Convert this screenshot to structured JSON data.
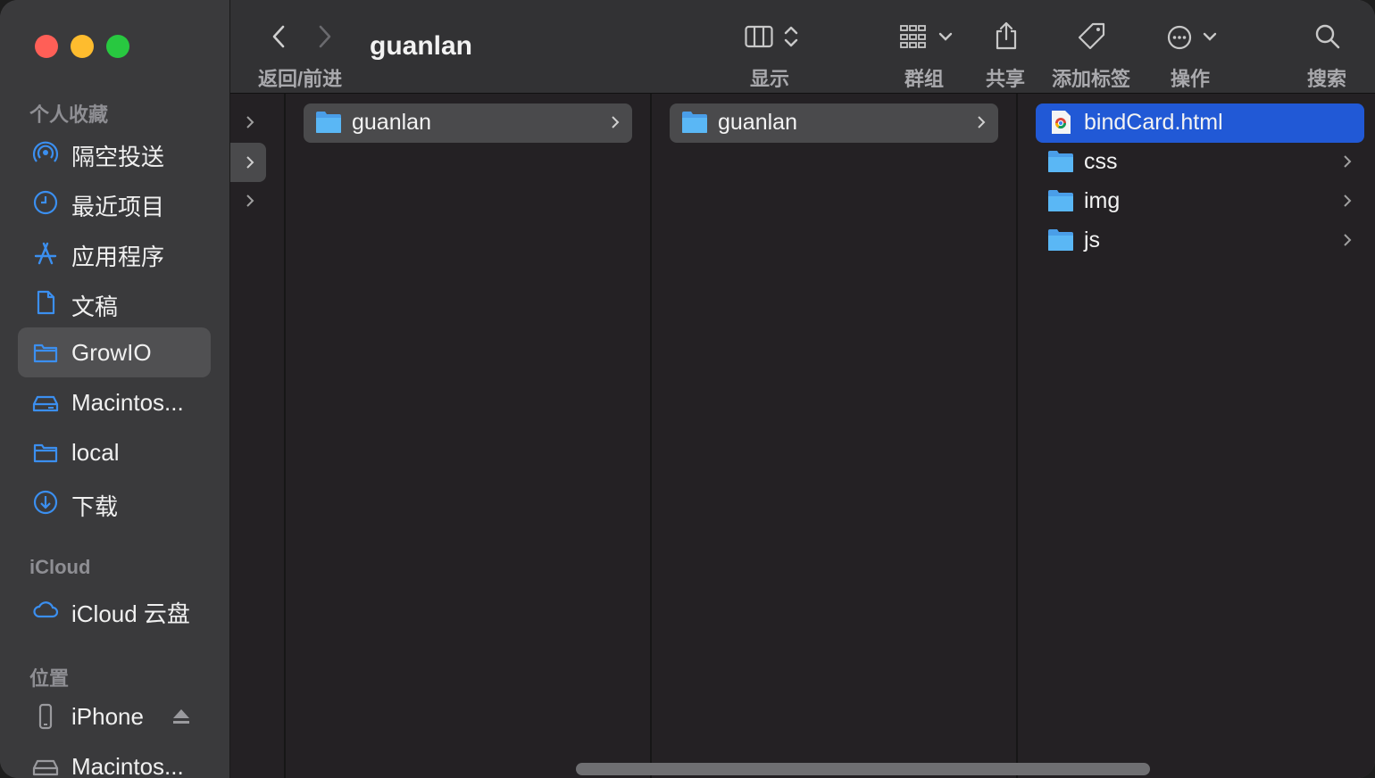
{
  "sidebar": {
    "favorites_title": "个人收藏",
    "favorites": [
      {
        "label": "隔空投送",
        "icon": "airdrop-icon"
      },
      {
        "label": "最近项目",
        "icon": "clock-icon"
      },
      {
        "label": "应用程序",
        "icon": "applications-icon"
      },
      {
        "label": "文稿",
        "icon": "document-icon"
      },
      {
        "label": "GrowIO",
        "icon": "folder-icon",
        "active": true
      },
      {
        "label": "Macintos...",
        "icon": "drive-icon"
      },
      {
        "label": "local",
        "icon": "folder-icon"
      },
      {
        "label": "下载",
        "icon": "download-icon"
      }
    ],
    "icloud_title": "iCloud",
    "icloud": [
      {
        "label": "iCloud 云盘",
        "icon": "cloud-icon"
      }
    ],
    "locations_title": "位置",
    "locations": [
      {
        "label": "iPhone",
        "icon": "iphone-icon"
      },
      {
        "label": "Macintos...",
        "icon": "drive-icon"
      }
    ]
  },
  "toolbar": {
    "title": "guanlan",
    "nav_label": "返回/前进",
    "view_label": "显示",
    "group_label": "群组",
    "share_label": "共享",
    "tag_label": "添加标签",
    "action_label": "操作",
    "search_label": "搜索"
  },
  "columns": {
    "col1": [
      {
        "name": "guanlan",
        "type": "folder",
        "selected": "grey"
      }
    ],
    "col2": [
      {
        "name": "guanlan",
        "type": "folder",
        "selected": "grey"
      }
    ],
    "col3": [
      {
        "name": "bindCard.html",
        "type": "html",
        "selected": "blue"
      },
      {
        "name": "css",
        "type": "folder"
      },
      {
        "name": "img",
        "type": "folder"
      },
      {
        "name": "js",
        "type": "folder"
      }
    ]
  },
  "colors": {
    "accent": "#2159d6",
    "sidebar_icon": "#3b8ff0",
    "folder": "#5ab0f0"
  }
}
